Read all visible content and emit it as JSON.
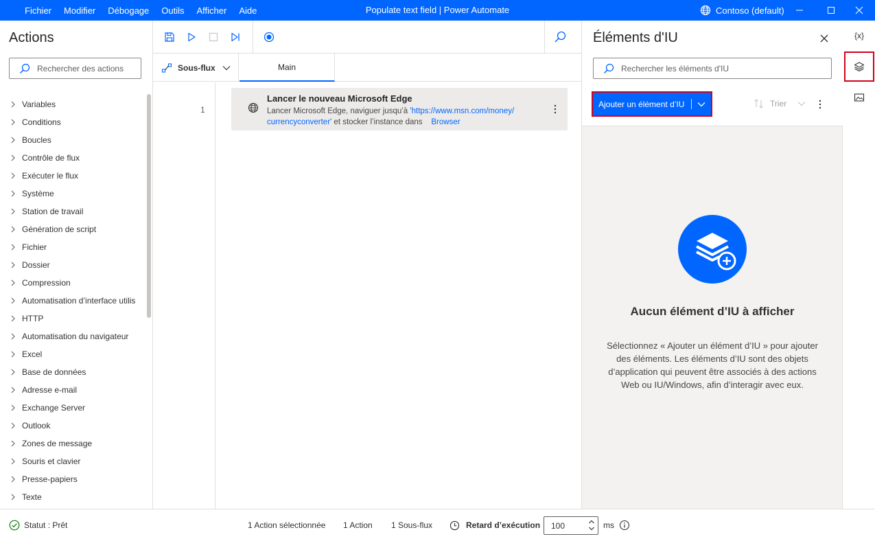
{
  "titlebar": {
    "menu": [
      "Fichier",
      "Modifier",
      "Débogage",
      "Outils",
      "Afficher",
      "Aide"
    ],
    "title": "Populate text field | Power Automate",
    "account": "Contoso (default)"
  },
  "actions_panel": {
    "title": "Actions",
    "search_placeholder": "Rechercher des actions",
    "items": [
      "Variables",
      "Conditions",
      "Boucles",
      "Contrôle de flux",
      "Exécuter le flux",
      "Système",
      "Station de travail",
      "Génération de script",
      "Fichier",
      "Dossier",
      "Compression",
      "Automatisation d’interface utilis",
      "HTTP",
      "Automatisation du navigateur",
      "Excel",
      "Base de données",
      "Adresse e-mail",
      "Exchange Server",
      "Outlook",
      "Zones de message",
      "Souris et clavier",
      "Presse-papiers",
      "Texte"
    ]
  },
  "editor": {
    "subflows_label": "Sous-flux",
    "main_tab": "Main",
    "steps": [
      {
        "number": "1",
        "title": "Lancer le nouveau Microsoft Edge",
        "desc_prefix": "Lancer Microsoft Edge, naviguer jusqu’à ",
        "url_line1": "'https://www.msn.com/money/",
        "url_line2": "currencyconverter'",
        "desc_mid": " et stocker l’instance dans ",
        "variable": "Browser"
      }
    ]
  },
  "ui_elements_panel": {
    "title": "Éléments d'IU",
    "search_placeholder": "Rechercher les éléments d'IU",
    "add_button": "Ajouter un élément d’IU",
    "sort_label": "Trier",
    "empty_title": "Aucun élément d’IU à afficher",
    "empty_desc": "Sélectionnez « Ajouter un élément d’IU » pour ajouter des éléments. Les éléments d’IU sont des objets d’application qui peuvent être associés à des actions Web ou IU/Windows, afin d’interagir avec eux."
  },
  "rail": {
    "variables_label": "{x}"
  },
  "statusbar": {
    "status": "Statut : Prêt",
    "selected": "1 Action sélectionnée",
    "actions": "1 Action",
    "subflows": "1 Sous-flux",
    "delay_label": "Retard d’exécution",
    "delay_value": "100",
    "unit": "ms"
  },
  "colors": {
    "accent": "#0066ff",
    "highlight_border": "#d0021b",
    "status_ok": "#107c10"
  }
}
